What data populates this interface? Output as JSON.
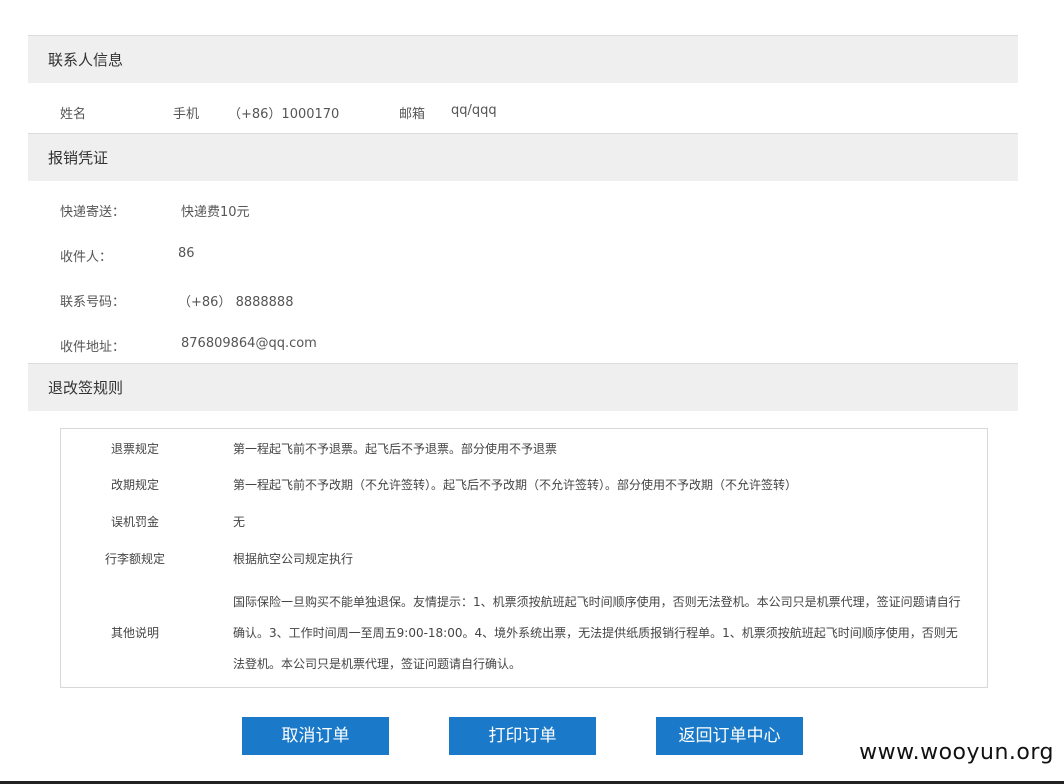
{
  "contact": {
    "title": "联系人信息",
    "name_label": "姓名",
    "phone_label": "手机",
    "phone_value": "（+86）1000170",
    "email_label": "邮箱",
    "email_value": "qq/qqq"
  },
  "reimburse": {
    "title": "报销凭证",
    "delivery_label": "快递寄送：",
    "delivery_value": "快递费10元",
    "receiver_label": "收件人：",
    "receiver_value": "86",
    "phone_label": "联系号码：",
    "phone_value": "（+86） 8888888",
    "address_label": "收件地址：",
    "address_value": "876809864@qq.com"
  },
  "rules": {
    "title": "退改签规则",
    "items": [
      {
        "label": "退票规定",
        "value": "第一程起飞前不予退票。起飞后不予退票。部分使用不予退票"
      },
      {
        "label": "改期规定",
        "value": "第一程起飞前不予改期（不允许签转）。起飞后不予改期（不允许签转）。部分使用不予改期（不允许签转）"
      },
      {
        "label": "误机罚金",
        "value": "无"
      },
      {
        "label": "行李额规定",
        "value": "根据航空公司规定执行"
      },
      {
        "label": "其他说明",
        "value": "国际保险一旦购买不能单独退保。友情提示：1、机票须按航班起飞时间顺序使用，否则无法登机。本公司只是机票代理，签证问题请自行确认。3、工作时间周一至周五9:00-18:00。4、境外系统出票，无法提供纸质报销行程单。1、机票须按航班起飞时间顺序使用，否则无法登机。本公司只是机票代理，签证问题请自行确认。"
      }
    ]
  },
  "buttons": {
    "cancel": "取消订单",
    "print": "打印订单",
    "back": "返回订单中心"
  },
  "watermark": "www.wooyun.org",
  "colors": {
    "button_bg": "#1a7ac9",
    "section_bg": "#efefef"
  }
}
